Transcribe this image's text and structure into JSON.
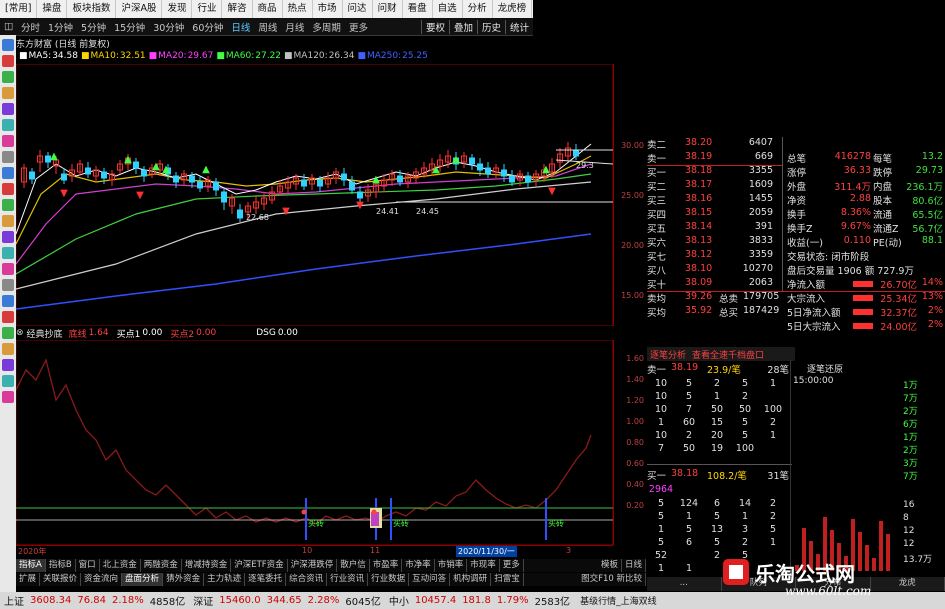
{
  "menubar": [
    "[常用]",
    "操盘",
    "板块指数",
    "沪深A股",
    "发现",
    "行业",
    "解咨",
    "商品",
    "热点",
    "市场",
    "问达",
    "问财",
    "看盘",
    "自选",
    "分析",
    "龙虎榜"
  ],
  "periods": [
    "分时",
    "1分钟",
    "5分钟",
    "15分钟",
    "30分钟",
    "60分钟",
    "日线",
    "周线",
    "月线",
    "多周期",
    "更多"
  ],
  "active_period": "日线",
  "period_right": [
    "要权",
    "叠加",
    "历史",
    "统计"
  ],
  "stock_title": "东方财富 (日线 前复权)",
  "ma": [
    {
      "label": "MA5:",
      "value": "34.58",
      "color": "#ffffff"
    },
    {
      "label": "MA10:",
      "value": "32.51",
      "color": "#ffd700"
    },
    {
      "label": "MA20:",
      "value": "29.67",
      "color": "#ff40ff"
    },
    {
      "label": "MA60:",
      "value": "27.22",
      "color": "#40ff40"
    },
    {
      "label": "MA120:",
      "value": "26.34",
      "color": "#c0c0c0"
    },
    {
      "label": "MA250:",
      "value": "25.25",
      "color": "#4060ff"
    }
  ],
  "price_axis": [
    "30.00",
    "25.00",
    "20.00",
    "15.00"
  ],
  "chart_marks": {
    "low_label": "22.68",
    "ref1": "24.41",
    "ref2": "24.45",
    "top_label": "29.3"
  },
  "indicator": {
    "name": "经典抄底",
    "line_label": "底线",
    "line_value": "1.64",
    "buy_label": "买点1",
    "buy_value": "0.00",
    "buy2_label": "买点2",
    "buy2_value": "0.00",
    "extra_label": "DSG",
    "extra_value": "0.00"
  },
  "indicator_axis": [
    "1.60",
    "1.40",
    "1.20",
    "1.00",
    "0.80",
    "0.60",
    "0.40",
    "0.20"
  ],
  "buy_signal_label": "买砖",
  "date_axis": {
    "left": "2020年",
    "d1": "10",
    "d2": "11",
    "d3": "2020/11/30/一",
    "d4": "3"
  },
  "tab_row1": [
    "指标A",
    "指标B",
    "窗口",
    "北上资金",
    "两融资金",
    "增减持资金",
    "沪深ETF资金",
    "沪深港跌停",
    "散户信",
    "市盈率",
    "市净率",
    "市销率",
    "市现率",
    "更多"
  ],
  "tab_row1_right": [
    "模板",
    "日线"
  ],
  "tab_row2": [
    "扩展",
    "关联报价",
    "资金流向",
    "盘面分析",
    "猜外资金",
    "主力轨迹",
    "逐笔委托",
    "综合资讯",
    "行业资讯",
    "行业数据",
    "互动问答",
    "机构调研",
    "扫雷宝"
  ],
  "tab_row2_right": "图交F10 新比较",
  "quote_sells": [
    {
      "label": "卖二",
      "price": "38.20",
      "vol": "6407"
    },
    {
      "label": "卖一",
      "price": "38.19",
      "vol": "669"
    }
  ],
  "quote_mid": [
    {
      "label": "买一",
      "price": "38.18",
      "vol": "3355"
    },
    {
      "label": "买二",
      "price": "38.17",
      "vol": "1609"
    },
    {
      "label": "买三",
      "price": "38.16",
      "vol": "1455"
    },
    {
      "label": "买四",
      "price": "38.15",
      "vol": "2059"
    },
    {
      "label": "买五",
      "price": "38.14",
      "vol": "391"
    },
    {
      "label": "买六",
      "price": "38.13",
      "vol": "3833"
    },
    {
      "label": "买七",
      "price": "38.12",
      "vol": "3359"
    },
    {
      "label": "买八",
      "price": "38.10",
      "vol": "10270"
    },
    {
      "label": "买十",
      "price": "38.09",
      "vol": "2063"
    }
  ],
  "quote_avg": [
    {
      "label": "卖均",
      "price": "39.26",
      "total_label": "总卖",
      "total": "179705"
    },
    {
      "label": "买均",
      "price": "35.92",
      "total_label": "总买",
      "total": "187429"
    }
  ],
  "stats": [
    {
      "l1": "总笔",
      "v1": "416278",
      "l2": "每笔",
      "v2": "13.2"
    },
    {
      "l1": "涨停",
      "v1": "36.33",
      "l2": "跌停",
      "v2": "29.73"
    },
    {
      "l1": "外盘",
      "v1": "311.4万",
      "l2": "内盘",
      "v2": "236.1万"
    },
    {
      "l1": "净资",
      "v1": "2.88",
      "l2": "股本",
      "v2": "80.6亿"
    },
    {
      "l1": "换手",
      "v1": "8.36%",
      "l2": "流通",
      "v2": "65.5亿"
    },
    {
      "l1": "换手Z",
      "v1": "9.67%",
      "l2": "流通Z",
      "v2": "56.7亿"
    },
    {
      "l1": "收益(一)",
      "v1": "0.110",
      "l2": "PE(动)",
      "v2": "88.1"
    }
  ],
  "trade_status": "交易状态: 闭市阶段",
  "after_hours": "盘后交易量 1906 额 727.9万",
  "flows": [
    {
      "label": "净流入额",
      "value": "26.70亿",
      "pct": "14%"
    },
    {
      "label": "大宗流入",
      "value": "25.34亿",
      "pct": "13%"
    },
    {
      "label": "5日净流入额",
      "value": "32.37亿",
      "pct": "2%"
    },
    {
      "label": "5日大宗流入",
      "value": "24.00亿",
      "pct": "2%"
    }
  ],
  "detail": {
    "hdr1": "逐笔分析",
    "hdr2": "查看全速千档盘口",
    "sell_label": "卖一",
    "sell_price": "38.19",
    "sell_avg": "23.9/笔",
    "sell_count": "28笔",
    "sell_rows": [
      [
        "10",
        "5",
        "2",
        "5",
        "1"
      ],
      [
        "10",
        "5",
        "1",
        "2",
        ""
      ],
      [
        "10",
        "7",
        "50",
        "50",
        "100"
      ],
      [
        "1",
        "60",
        "15",
        "5",
        "2"
      ],
      [
        "10",
        "2",
        "20",
        "5",
        "1"
      ],
      [
        "7",
        "50",
        "19",
        "100",
        ""
      ]
    ],
    "buy_label": "买一",
    "buy_price": "38.18",
    "buy_avg": "108.2/笔",
    "buy_count": "31笔",
    "buy_first": "2964",
    "buy_rows": [
      [
        "5",
        "124",
        "6",
        "14",
        "2"
      ],
      [
        "5",
        "1",
        "5",
        "1",
        "2"
      ],
      [
        "1",
        "5",
        "13",
        "3",
        "5"
      ],
      [
        "5",
        "6",
        "5",
        "2",
        "1"
      ],
      [
        "52",
        "",
        "2",
        "5",
        ""
      ],
      [
        "1",
        "1",
        "",
        "",
        ""
      ]
    ]
  },
  "right_panel_title": "逐笔还原",
  "right_panel_time": "15:00:00",
  "right_panel_side": [
    "1万",
    "7万",
    "2万",
    "6万",
    "1万",
    "2万",
    "3万",
    "7万"
  ],
  "right_panel_bottom": [
    "16",
    "8",
    "12",
    "12",
    "13.7万"
  ],
  "bottom_tabs": [
    "...",
    "队列",
    "分布",
    "龙虎"
  ],
  "ticker": [
    {
      "name": "上证",
      "price": "3608.34",
      "chg": "76.84",
      "pct": "2.18%",
      "amount": "4858亿"
    },
    {
      "name": "深证",
      "price": "15460.0",
      "chg": "344.65",
      "pct": "2.28%",
      "amount": "6045亿"
    },
    {
      "name": "中小",
      "price": "10457.4",
      "chg": "181.8",
      "pct": "1.79%",
      "amount": "2583亿"
    }
  ],
  "ticker_right": "基级行情_上海双线",
  "watermark": {
    "title": "乐淘公式网",
    "url": "www.60lt.com"
  }
}
